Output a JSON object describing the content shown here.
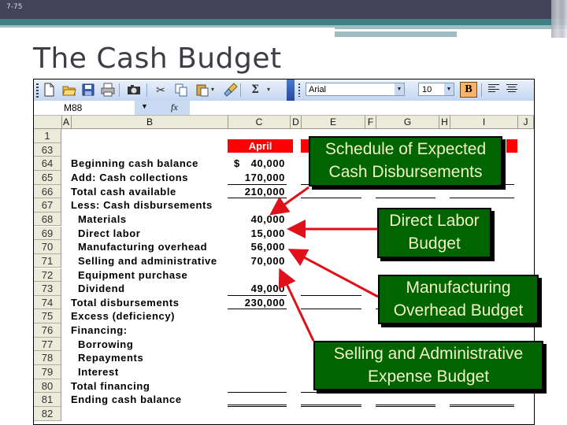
{
  "slide": {
    "number": "7-75",
    "title": "The Cash Budget"
  },
  "toolbar": {
    "icons": [
      "new-icon",
      "open-icon",
      "save-icon",
      "print-icon",
      "camera-icon",
      "cut-icon",
      "copy-icon",
      "paste-icon",
      "format-painter-icon",
      "autosum-icon"
    ],
    "font_name": "Arial",
    "font_size": "10",
    "bold_label": "B",
    "sigma": "Σ",
    "dropdown": "▾"
  },
  "formula_bar": {
    "name_box": "M88",
    "fx_label": "fx",
    "formula": ""
  },
  "columns": [
    "A",
    "B",
    "C",
    "D",
    "E",
    "F",
    "G",
    "H",
    "I",
    "J"
  ],
  "rows": [
    {
      "num": "1",
      "label": "",
      "value": ""
    },
    {
      "num": "63",
      "label": "",
      "value": ""
    },
    {
      "num": "64",
      "label": "Beginning cash balance",
      "value": "40,000",
      "prefix": "$"
    },
    {
      "num": "65",
      "label": "Add: Cash collections",
      "value": "170,000"
    },
    {
      "num": "66",
      "label": "Total cash available",
      "value": "210,000"
    },
    {
      "num": "67",
      "label": "Less: Cash disbursements",
      "value": ""
    },
    {
      "num": "68",
      "label": "Materials",
      "value": "40,000",
      "indent": true
    },
    {
      "num": "69",
      "label": "Direct labor",
      "value": "15,000",
      "indent": true
    },
    {
      "num": "70",
      "label": "Manufacturing overhead",
      "value": "56,000",
      "indent": true
    },
    {
      "num": "71",
      "label": "Selling and administrative",
      "value": "70,000",
      "indent": true
    },
    {
      "num": "72",
      "label": "Equipment purchase",
      "value": "-",
      "indent": true
    },
    {
      "num": "73",
      "label": "Dividend",
      "value": "49,000",
      "indent": true
    },
    {
      "num": "74",
      "label": "Total disbursements",
      "value": "230,000"
    },
    {
      "num": "75",
      "label": "Excess (deficiency)",
      "value": ""
    },
    {
      "num": "76",
      "label": "Financing:",
      "value": ""
    },
    {
      "num": "77",
      "label": "Borrowing",
      "value": "",
      "indent": true
    },
    {
      "num": "78",
      "label": "Repayments",
      "value": "",
      "indent": true
    },
    {
      "num": "79",
      "label": "Interest",
      "value": "",
      "indent": true
    },
    {
      "num": "80",
      "label": "Total financing",
      "value": ""
    },
    {
      "num": "81",
      "label": "Ending cash balance",
      "value": ""
    },
    {
      "num": "82",
      "label": "",
      "value": ""
    }
  ],
  "month_header": "April",
  "colors": {
    "header_red": "#ff0000",
    "callout_green": "#006400",
    "callout_text": "#f2f2c8",
    "arrow_red": "#e0101a"
  },
  "callouts": [
    {
      "id": "cash-disbursements",
      "line1": "Schedule of Expected",
      "line2": "Cash Disbursements",
      "points_to_row": "68"
    },
    {
      "id": "direct-labor",
      "line1": "Direct Labor",
      "line2": "Budget",
      "points_to_row": "69"
    },
    {
      "id": "mfg-overhead",
      "line1": "Manufacturing",
      "line2": "Overhead Budget",
      "points_to_row": "70"
    },
    {
      "id": "selling-admin",
      "line1": "Selling and Administrative",
      "line2": "Expense Budget",
      "points_to_row": "71"
    }
  ]
}
